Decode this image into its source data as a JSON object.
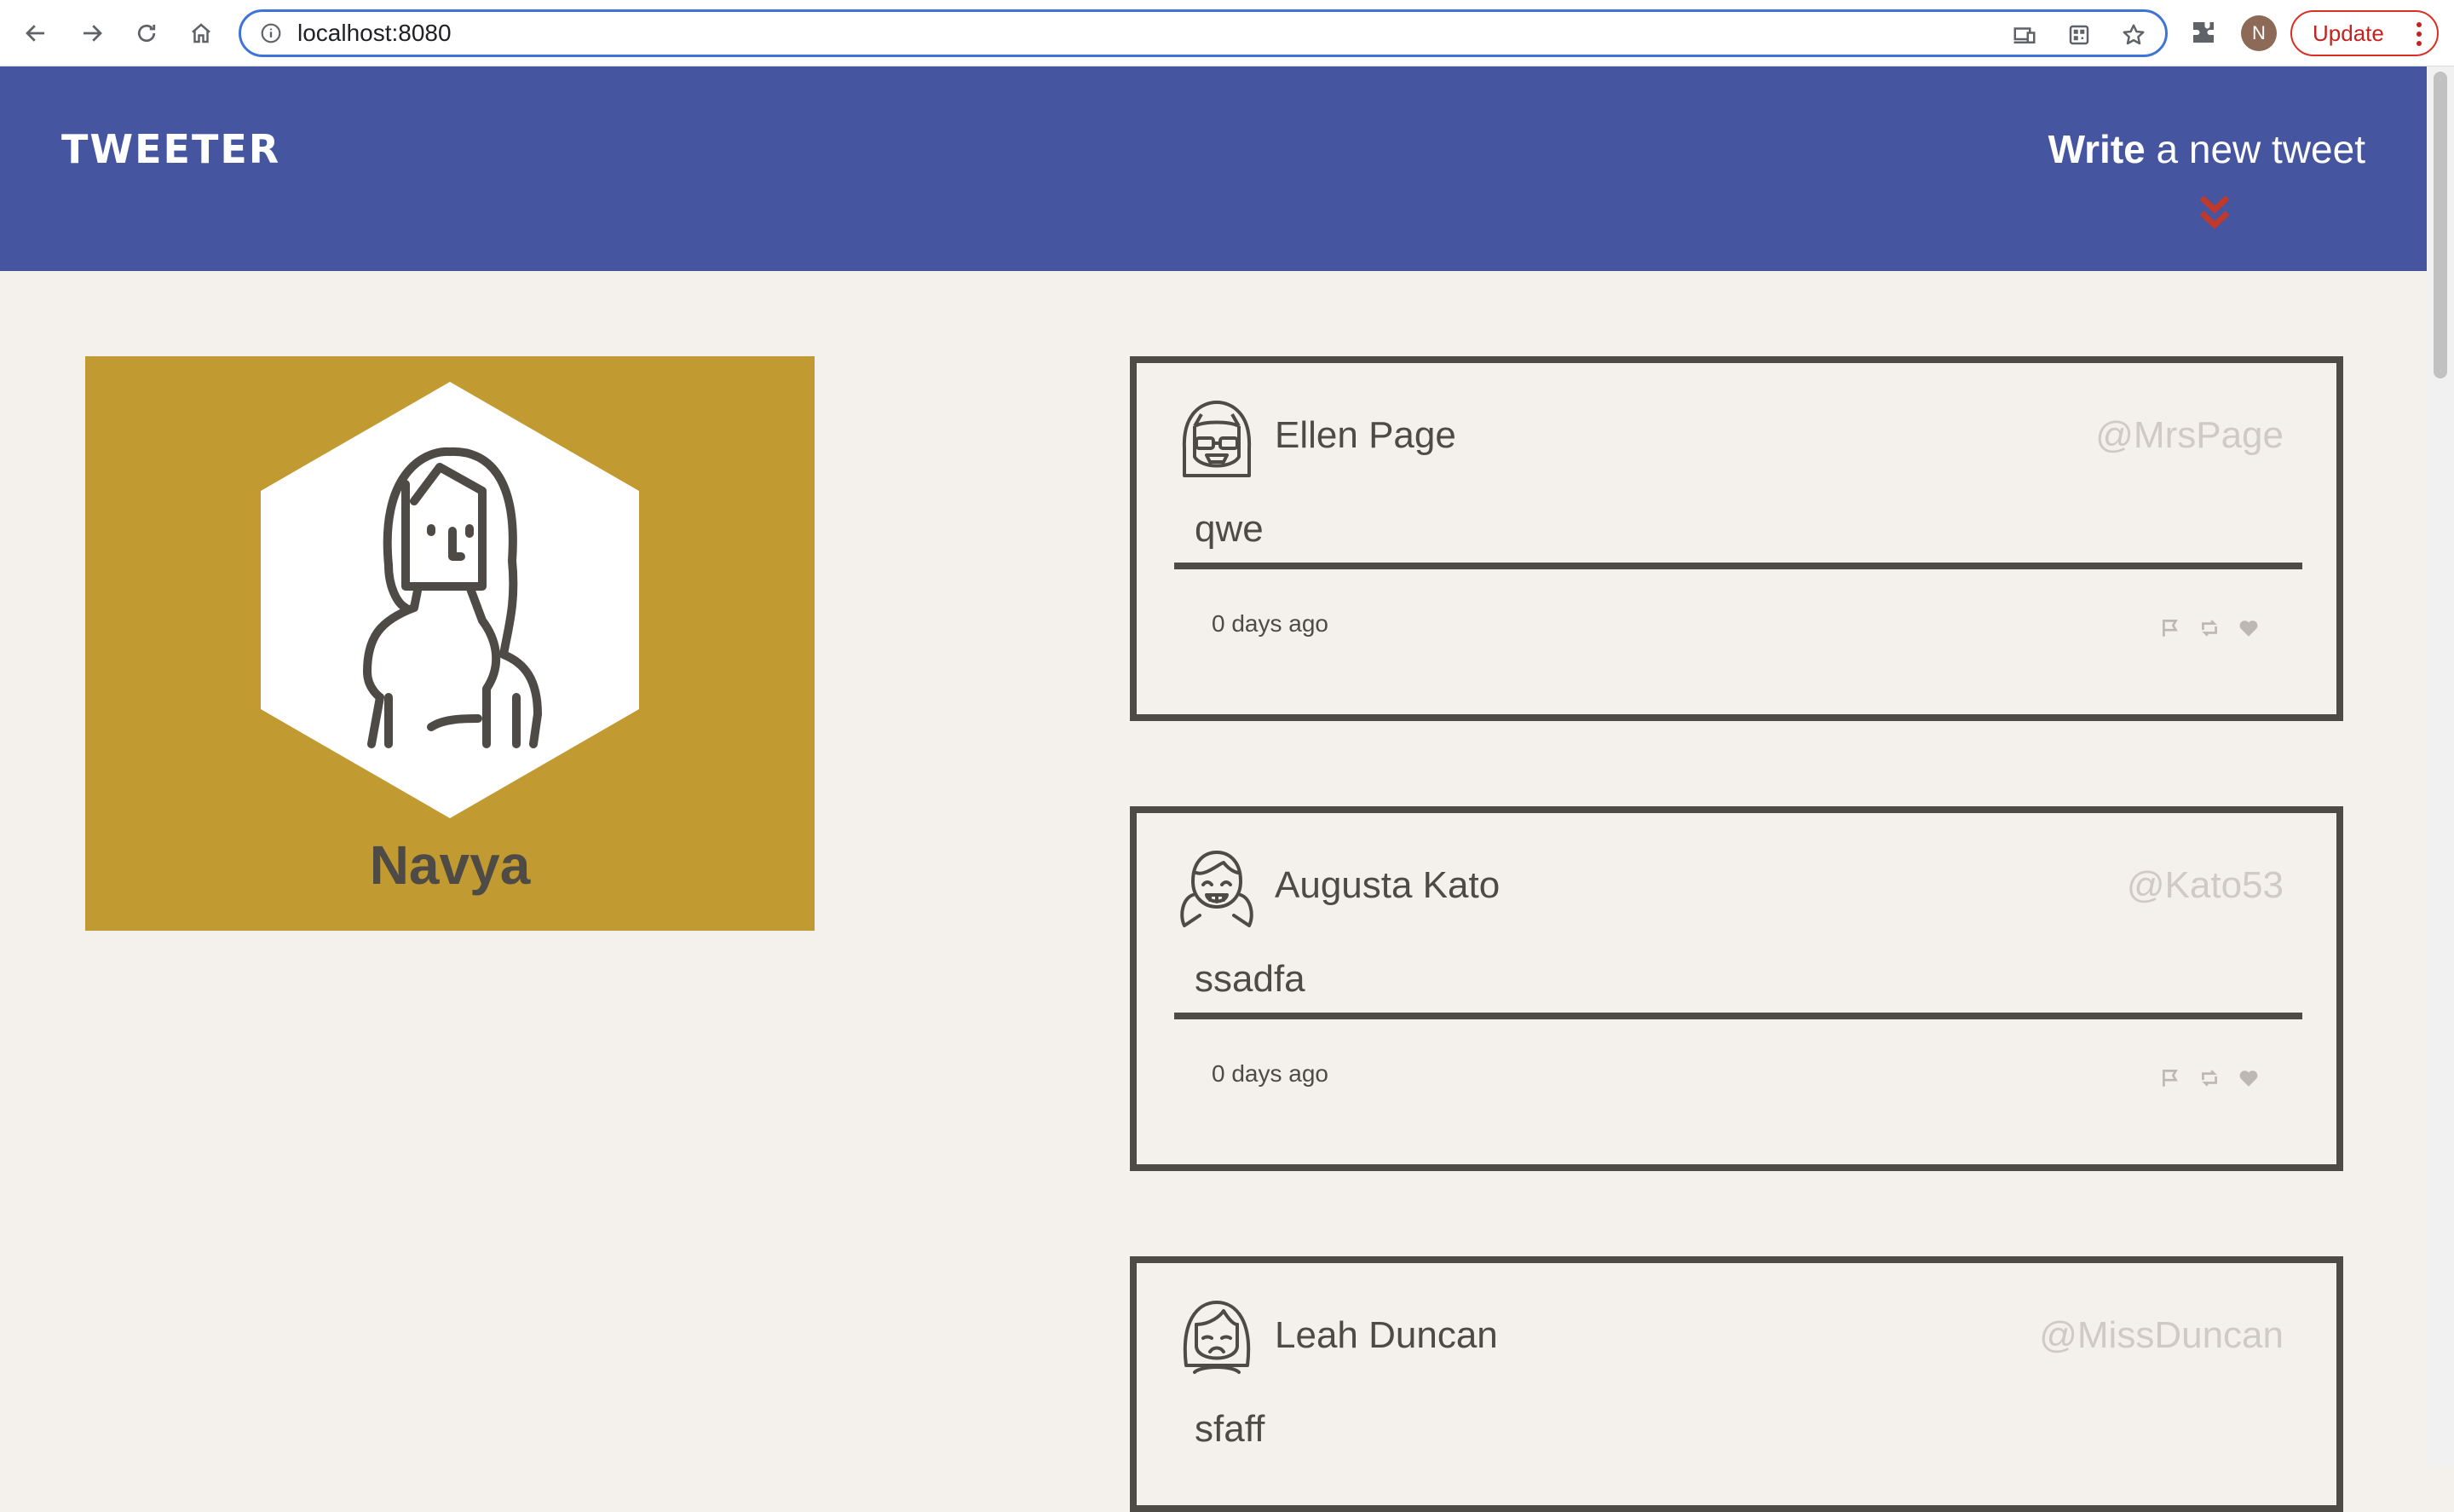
{
  "browser": {
    "url": "localhost:8080",
    "update_label": "Update",
    "profile_initial": "N"
  },
  "header": {
    "logo": "TWEETER",
    "write_bold": "Write",
    "write_rest": " a new tweet",
    "accent_color": "#c0392b",
    "bg_color": "#4555a0"
  },
  "profile": {
    "name": "Navya",
    "bg_color": "#c19a31"
  },
  "tweets": [
    {
      "name": "Ellen Page",
      "handle": "@MrsPage",
      "text": "qwe",
      "date": "0 days ago",
      "avatar": "girl-glasses-icon"
    },
    {
      "name": "Augusta Kato",
      "handle": "@Kato53",
      "text": "ssadfa",
      "date": "0 days ago",
      "avatar": "girl-pigtails-icon"
    },
    {
      "name": "Leah Duncan",
      "handle": "@MissDuncan",
      "text": "sfaff",
      "date": "",
      "avatar": "girl-sad-icon"
    }
  ]
}
